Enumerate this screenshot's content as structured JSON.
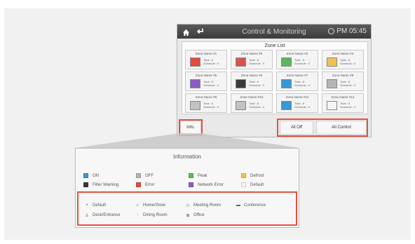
{
  "header": {
    "title": "Control & Monitoring",
    "time": "PM 05:45"
  },
  "zone_list": {
    "title": "Zone List",
    "total_label": "Total : 8",
    "schedule_label": "Schedule : 0",
    "zones": [
      {
        "name": "Zone Name #1",
        "status": "Error",
        "color": "#e24b3f"
      },
      {
        "name": "Zone Name #2",
        "status": "Error",
        "color": "#d9534f"
      },
      {
        "name": "Zone Name #3",
        "status": "Peak",
        "color": "#5cb85c"
      },
      {
        "name": "Zone Name #4",
        "status": "Defrost",
        "color": "#f2c14e"
      },
      {
        "name": "Zone Name #5",
        "status": "Network Error",
        "color": "#8a5cc7"
      },
      {
        "name": "Zone Name #6",
        "status": "Filter Warning",
        "color": "#3a3a3a"
      },
      {
        "name": "Zone Name #7",
        "status": "ON",
        "color": "#3a97d4"
      },
      {
        "name": "Zone Name #8",
        "status": "OFF",
        "color": "#b5b5b5"
      },
      {
        "name": "Zone Name #9",
        "status": "OFF",
        "color": "#c2c2c2"
      },
      {
        "name": "Zone Name #10",
        "status": "OFF",
        "color": "#c2c2c2"
      },
      {
        "name": "Zone Name #11",
        "status": "ON",
        "color": "#3a97d4"
      },
      {
        "name": "Zone Name #12",
        "status": "Default",
        "color": "#f4f4f4"
      }
    ]
  },
  "footer": {
    "info": "Info.",
    "all_off": "All Off",
    "all_control": "All Control"
  },
  "information": {
    "title": "Information",
    "legend": [
      {
        "label": "ON",
        "color": "#3a97d4"
      },
      {
        "label": "OFF",
        "color": "#b5b5b5"
      },
      {
        "label": "Peak",
        "color": "#5cb85c"
      },
      {
        "label": "Defrost",
        "color": "#f2c14e"
      },
      {
        "label": "Filter Warning",
        "color": "#3a3a3a"
      },
      {
        "label": "Error",
        "color": "#e24b3f"
      },
      {
        "label": "Network Error",
        "color": "#8a5cc7"
      },
      {
        "label": "Default",
        "color": "#f4f4f4"
      }
    ],
    "modes": [
      {
        "label": "Default",
        "icon": "dot-icon"
      },
      {
        "label": "Home/Store",
        "icon": "home-icon"
      },
      {
        "label": "Meeting Room",
        "icon": "meeting-icon"
      },
      {
        "label": "Conference",
        "icon": "conference-icon"
      },
      {
        "label": "Desk/Entrance",
        "icon": "desk-icon"
      },
      {
        "label": "Dining Room",
        "icon": "dining-icon"
      },
      {
        "label": "Office",
        "icon": "office-icon"
      }
    ]
  },
  "colors": {
    "highlight": "#e5533e",
    "header": "#4a4a4a"
  }
}
